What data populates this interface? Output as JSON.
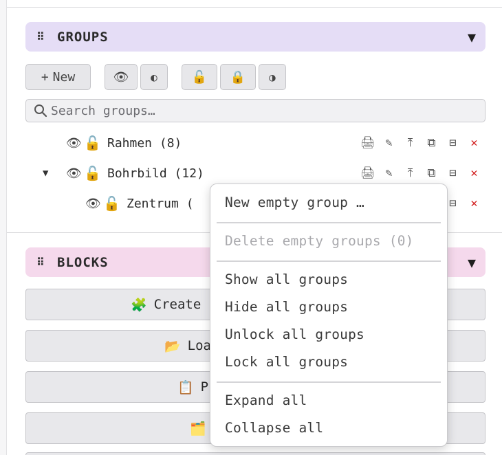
{
  "groups_panel": {
    "title": "GROUPS",
    "new_button": {
      "icon": "+",
      "label": "New"
    },
    "search": {
      "placeholder": "Search groups…",
      "value": ""
    },
    "tree": [
      {
        "label": "Rahmen (8)"
      },
      {
        "label": "Bohrbild (12)"
      },
      {
        "label": "Zentrum ("
      }
    ]
  },
  "blocks_panel": {
    "title": "BLOCKS",
    "buttons": [
      {
        "icon": "🧩",
        "label": "Create"
      },
      {
        "icon": "📂",
        "label": "Loa"
      },
      {
        "icon": "📋",
        "label": "P"
      },
      {
        "icon": "🗂️",
        "label": ""
      }
    ]
  },
  "context_menu": {
    "items": [
      {
        "label": "New empty group …",
        "enabled": true
      },
      {
        "label": "Delete empty groups (0)",
        "enabled": false
      },
      {
        "label": "Show all groups",
        "enabled": true
      },
      {
        "label": "Hide all groups",
        "enabled": true
      },
      {
        "label": "Unlock all groups",
        "enabled": true
      },
      {
        "label": "Lock all groups",
        "enabled": true
      },
      {
        "label": "Expand all",
        "enabled": true
      },
      {
        "label": "Collapse all",
        "enabled": true
      }
    ]
  },
  "colors": {
    "groups_header_bg": "#e5ddf6",
    "blocks_header_bg": "#f5d9ec",
    "delete_icon": "#d21f1f",
    "lock_icon": "#f0a500"
  }
}
